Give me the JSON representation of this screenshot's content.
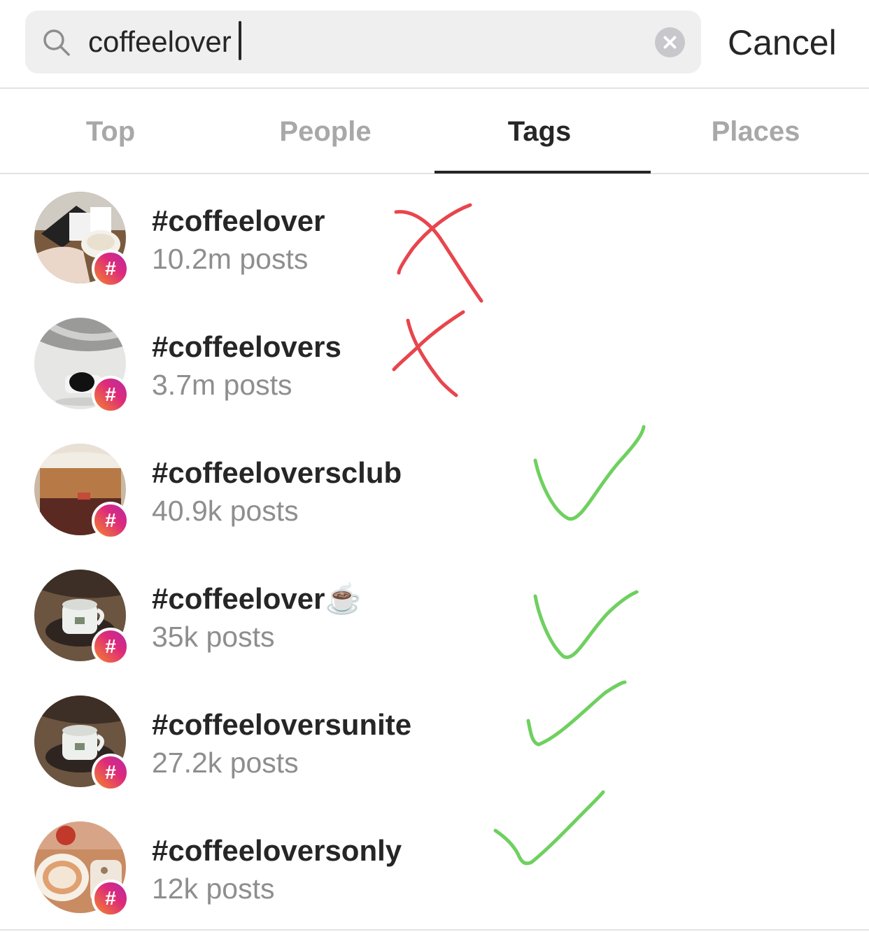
{
  "search": {
    "value": "coffeelover",
    "clear_label": "clear",
    "cancel_label": "Cancel"
  },
  "tabs": [
    {
      "label": "Top",
      "active": false
    },
    {
      "label": "People",
      "active": false
    },
    {
      "label": "Tags",
      "active": true
    },
    {
      "label": "Places",
      "active": false
    }
  ],
  "badge_symbol": "#",
  "results": [
    {
      "tag": "#coffeelover",
      "count": "10.2m posts",
      "mark": "x"
    },
    {
      "tag": "#coffeelovers",
      "count": "3.7m posts",
      "mark": "x"
    },
    {
      "tag": "#coffeeloversclub",
      "count": "40.9k posts",
      "mark": "check"
    },
    {
      "tag": "#coffeelover☕️",
      "count": "35k posts",
      "mark": "check"
    },
    {
      "tag": "#coffeeloversunite",
      "count": "27.2k posts",
      "mark": "check"
    },
    {
      "tag": "#coffeeloversonly",
      "count": "12k posts",
      "mark": "check"
    }
  ],
  "colors": {
    "annotation_x": "#e8454d",
    "annotation_check": "#6fd060",
    "active_tab": "#262626",
    "inactive_tab": "#a8a8a8",
    "secondary_text": "#8e8e8e"
  },
  "icons": {
    "search": "search-icon",
    "clear": "clear-icon",
    "hashtag_badge": "hashtag-badge-icon"
  }
}
